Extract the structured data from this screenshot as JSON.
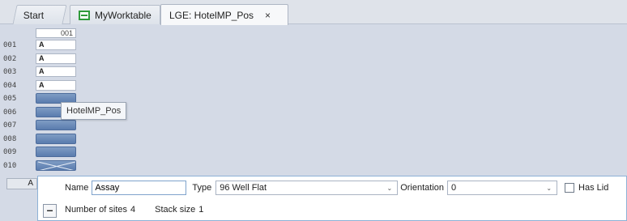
{
  "tabs": [
    {
      "label": "Start"
    },
    {
      "label": "MyWorktable"
    },
    {
      "label": "LGE: HotelMP_Pos",
      "close": "×"
    }
  ],
  "grid": {
    "column_header": "001",
    "rows": [
      {
        "label": "001",
        "content": "A"
      },
      {
        "label": "002",
        "content": "A"
      },
      {
        "label": "003",
        "content": "A"
      },
      {
        "label": "004",
        "content": "A"
      },
      {
        "label": "005",
        "content": ""
      },
      {
        "label": "006",
        "content": ""
      },
      {
        "label": "007",
        "content": ""
      },
      {
        "label": "008",
        "content": ""
      },
      {
        "label": "009",
        "content": ""
      },
      {
        "label": "010",
        "content": ""
      }
    ],
    "tooltip": "HotelMP_Pos"
  },
  "bottom_tab_label": "A",
  "properties": {
    "name_label": "Name",
    "name_value": "Assay",
    "type_label": "Type",
    "type_value": "96 Well Flat",
    "orientation_label": "Orientation",
    "orientation_value": "0",
    "has_lid_label": "Has Lid",
    "has_lid_checked": false,
    "sites_label": "Number of sites",
    "sites_value": "4",
    "stack_label": "Stack size",
    "stack_value": "1",
    "collapse_symbol": "–"
  },
  "colors": {
    "accent": "#5a7cae",
    "worktable_icon": "#2f9a3a",
    "panel_border": "#8db1d6"
  }
}
